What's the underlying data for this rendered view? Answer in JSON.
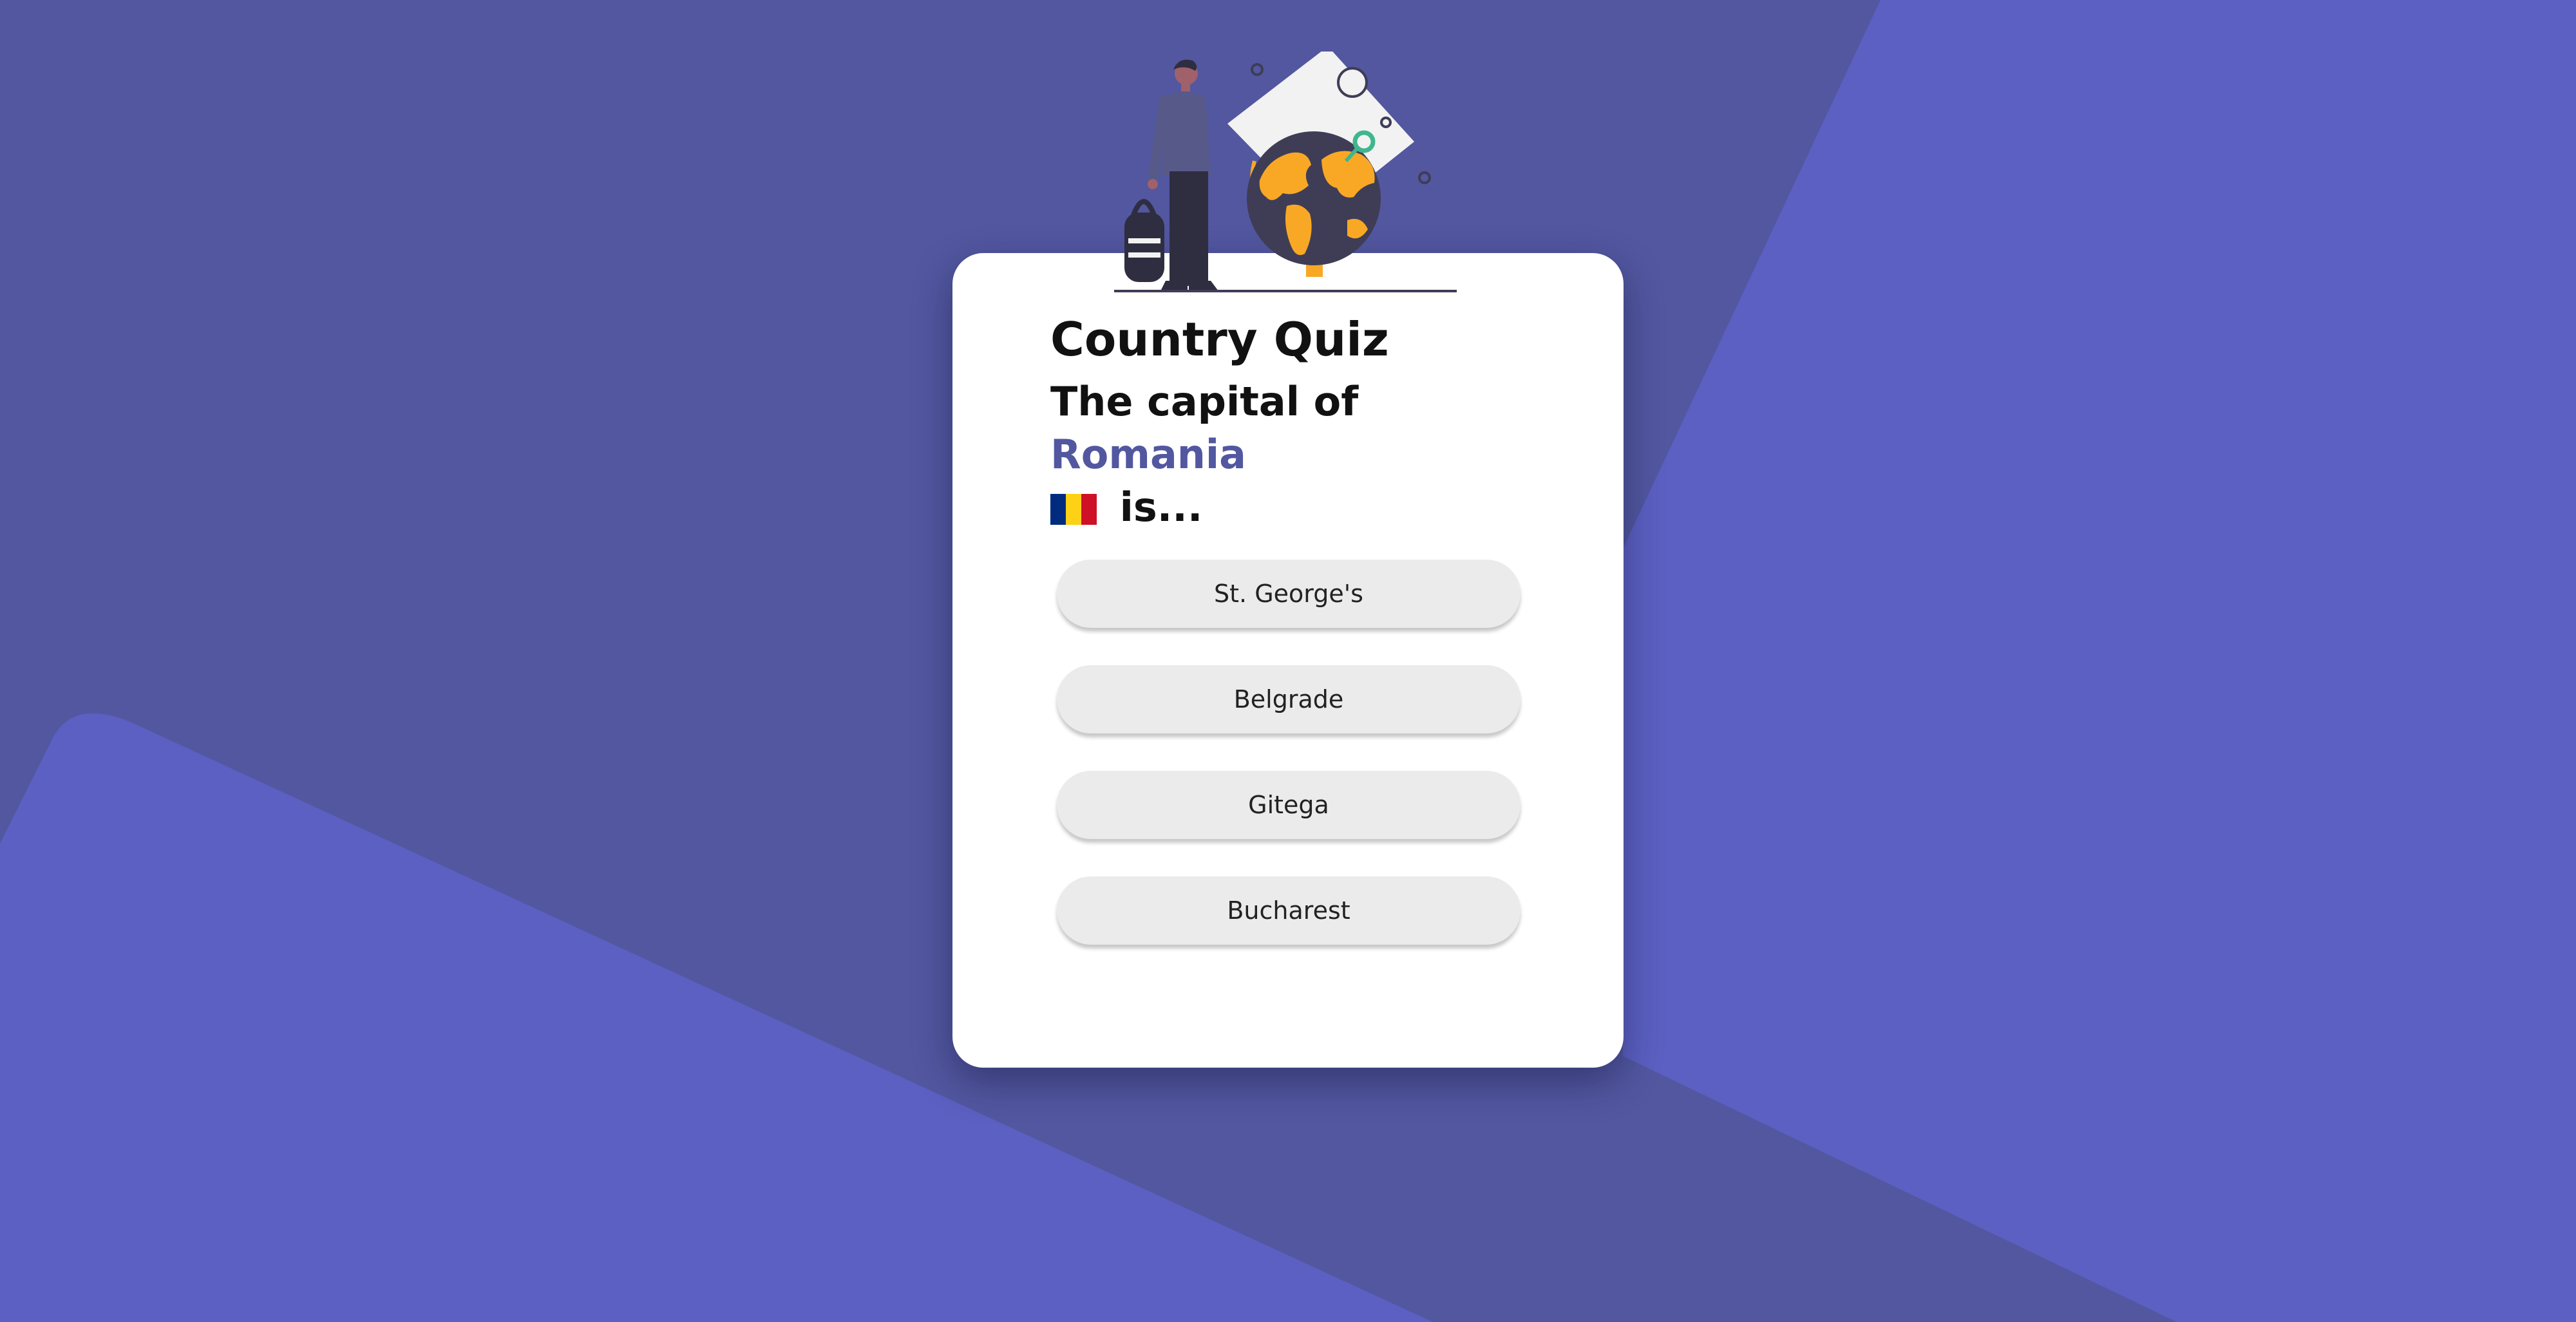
{
  "quiz": {
    "title": "Country Quiz",
    "question_prefix": "The capital of ",
    "country": "Romania",
    "question_suffix": " is...",
    "flag": {
      "icon": "romania-flag-icon",
      "colors": [
        "#002B7F",
        "#FCD116",
        "#CE1126"
      ]
    },
    "answers": [
      {
        "label": "St. George's"
      },
      {
        "label": "Belgrade"
      },
      {
        "label": "Gitega"
      },
      {
        "label": "Bucharest"
      }
    ]
  },
  "theme": {
    "background": "#5257A0",
    "background_accent": "#5B60C2",
    "card": "#FFFFFF",
    "button": "#EBEBEB",
    "country_highlight": "#5257A0"
  },
  "illustration": {
    "icon": "traveler-globe-illustration"
  }
}
